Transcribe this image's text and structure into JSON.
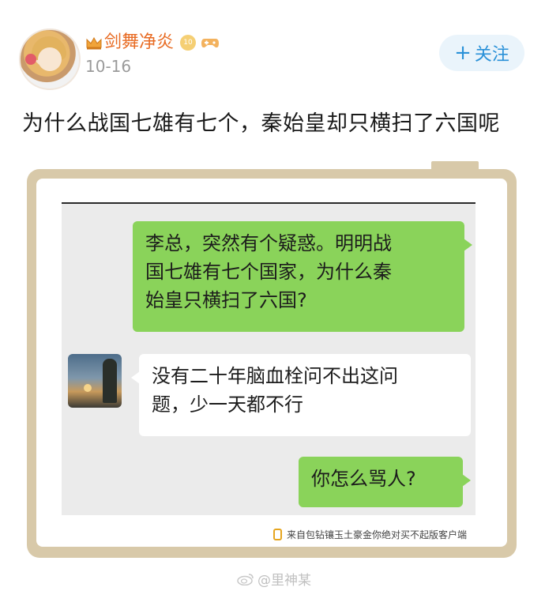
{
  "post": {
    "username": "剑舞净炎",
    "level_badge": "10",
    "date": "10-16",
    "follow_label": "关注",
    "follow_plus": "+",
    "title": "为什么战国七雄有七个，秦始皇却只横扫了六国呢"
  },
  "chat": {
    "messages": [
      {
        "side": "right",
        "color": "green",
        "text_lines": [
          "李总，突然有个疑惑。明明战",
          "国七雄有七个国家，为什么秦",
          "始皇只横扫了六国?"
        ]
      },
      {
        "side": "left",
        "color": "white",
        "text_lines": [
          "没有二十年脑血栓问不出这问",
          "题，少一天都不行"
        ]
      },
      {
        "side": "right",
        "color": "green",
        "text_lines": [
          "你怎么骂人?"
        ]
      }
    ],
    "source_text": "来自包钻镶玉土豪金你绝对买不起版客户端"
  },
  "watermark": "@里神某",
  "colors": {
    "username": "#e86b23",
    "follow_text": "#2a91d8",
    "follow_bg": "#eaf4fb",
    "bubble_green": "#8ad35a",
    "frame": "#d8c9a9"
  },
  "icons": [
    "crown-icon",
    "level-badge-icon",
    "game-controller-icon",
    "plus-icon",
    "phone-icon",
    "weibo-icon"
  ]
}
